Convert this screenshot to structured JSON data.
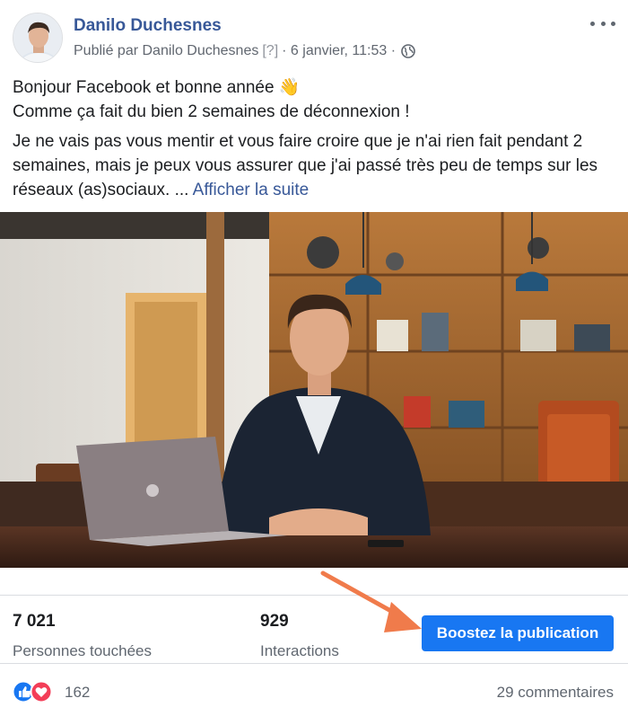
{
  "header": {
    "author": "Danilo Duchesnes",
    "published_prefix": "Publié par Danilo Duchesnes",
    "help_marker": "[?]",
    "date": "· 6 janvier, 11:53 ·"
  },
  "post": {
    "line1": "Bonjour Facebook et bonne année 👋",
    "line2": "Comme ça fait du bien 2 semaines de déconnexion !",
    "body": "Je ne vais pas vous mentir et vous faire croire que je n'ai rien fait pendant 2 semaines, mais je peux vous assurer que j'ai passé très peu de temps sur les réseaux (as)sociaux. ...",
    "see_more": "Afficher la suite"
  },
  "stats": {
    "reach_value": "7 021",
    "reach_label": "Personnes touchées",
    "interactions_value": "929",
    "interactions_label": "Interactions",
    "boost_button": "Boostez la publication"
  },
  "reactions": {
    "count": "162",
    "comments": "29 commentaires"
  },
  "colors": {
    "brand_blue": "#1877f2",
    "link_blue": "#385898",
    "arrow": "#f07b4b",
    "love_red": "#f33e58"
  }
}
